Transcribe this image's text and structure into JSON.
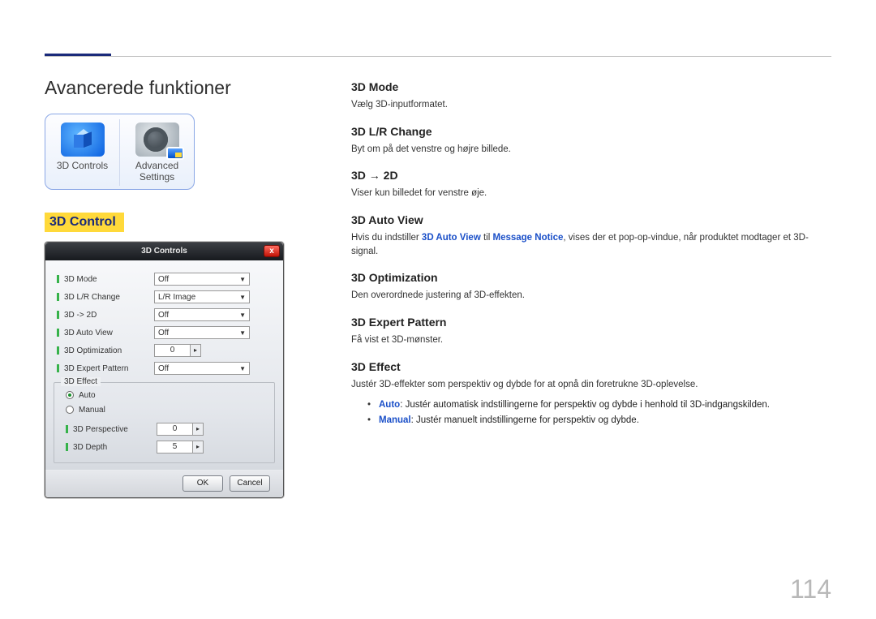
{
  "page": {
    "title": "Avancerede funktioner",
    "section": "3D Control",
    "number": "114"
  },
  "icon_panel": {
    "tile1": {
      "label_l1": "3D Controls"
    },
    "tile2": {
      "label_l1": "Advanced",
      "label_l2": "Settings"
    }
  },
  "dialog": {
    "title": "3D Controls",
    "options": [
      {
        "label": "3D Mode",
        "value": "Off",
        "type": "dropdown"
      },
      {
        "label": "3D L/R Change",
        "value": "L/R Image",
        "type": "dropdown"
      },
      {
        "label": "3D -> 2D",
        "value": "Off",
        "type": "dropdown"
      },
      {
        "label": "3D Auto View",
        "value": "Off",
        "type": "dropdown"
      },
      {
        "label": "3D Optimization",
        "value": "0",
        "type": "spinner"
      },
      {
        "label": "3D Expert Pattern",
        "value": "Off",
        "type": "dropdown"
      }
    ],
    "effect_group": {
      "title": "3D Effect",
      "radios": [
        {
          "label": "Auto",
          "selected": true
        },
        {
          "label": "Manual",
          "selected": false
        }
      ],
      "subs": [
        {
          "label": "3D Perspective",
          "value": "0"
        },
        {
          "label": "3D Depth",
          "value": "5"
        }
      ]
    },
    "buttons": {
      "ok": "OK",
      "cancel": "Cancel"
    }
  },
  "right": {
    "s1_h": "3D Mode",
    "s1_p": "Vælg 3D-inputformatet.",
    "s2_h": "3D L/R Change",
    "s2_p": "Byt om på det venstre og højre billede.",
    "s3_h": "3D → 2D",
    "s3_p": "Viser kun billedet for venstre øje.",
    "s4_h": "3D Auto View",
    "s4_pre": "Hvis du indstiller ",
    "s4_kw1": "3D Auto View",
    "s4_mid": " til ",
    "s4_kw2": "Message Notice",
    "s4_post": ", vises der et pop-op-vindue, når produktet modtager et 3D-signal.",
    "s5_h": "3D Optimization",
    "s5_p": "Den overordnede justering af 3D-effekten.",
    "s6_h": "3D Expert Pattern",
    "s6_p": "Få vist et 3D-mønster.",
    "s7_h": "3D Effect",
    "s7_p": "Justér 3D-effekter som perspektiv og dybde for at opnå din foretrukne 3D-oplevelse.",
    "s7_b1_kw": "Auto",
    "s7_b1_txt": ": Justér automatisk indstillingerne for perspektiv og dybde i henhold til 3D-indgangskilden.",
    "s7_b2_kw": "Manual",
    "s7_b2_txt": ": Justér manuelt indstillingerne for perspektiv og dybde."
  }
}
